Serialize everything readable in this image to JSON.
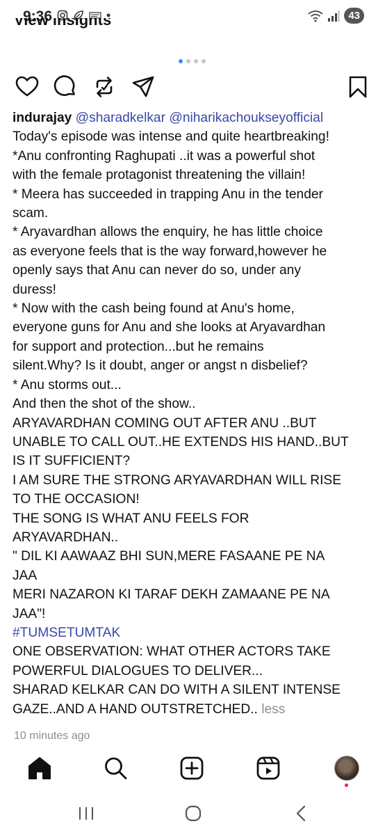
{
  "status_bar": {
    "time": "9:36",
    "battery": "43"
  },
  "header": {
    "view_insights": "View insights"
  },
  "carousel": {
    "dots": 4,
    "active_index": 0
  },
  "post": {
    "username": "indurajay",
    "mentions": [
      "@sharadkelkar",
      "@niharikachoukseyofficial"
    ],
    "caption_lines": [
      "Today's episode was intense and quite heartbreaking!",
      "*Anu confronting Raghupati ..it was a powerful shot",
      "with the female protagonist threatening the villain!",
      "* Meera has succeeded in trapping Anu in the tender",
      "scam.",
      "* Aryavardhan allows the enquiry, he has little choice",
      "as everyone feels that is the way forward,however he",
      "openly says that Anu can never do so, under any",
      "duress!",
      "* Now with the cash being found at Anu's home,",
      "everyone guns for Anu and she looks at Aryavardhan",
      "for support and protection...but he remains",
      "silent.Why? Is it doubt, anger or angst n disbelief?",
      "* Anu storms out...",
      "And then the shot of the show..",
      "ARYAVARDHAN COMING OUT AFTER ANU ..BUT",
      "UNABLE TO CALL OUT..HE EXTENDS HIS HAND..BUT",
      "IS IT SUFFICIENT?",
      "I AM SURE THE STRONG ARYAVARDHAN WILL RISE",
      "TO THE OCCASION!",
      "THE SONG IS WHAT ANU FEELS FOR",
      "ARYAVARDHAN..",
      "\" DIL KI AAWAAZ BHI SUN,MERE FASAANE PE NA",
      "JAA",
      "MERI NAZARON KI TARAF DEKH ZAMAANE PE NA",
      "JAA\"!"
    ],
    "hashtag": "#TUMSETUMTAK",
    "caption_tail_lines": [
      "ONE OBSERVATION: WHAT OTHER ACTORS TAKE",
      "POWERFUL DIALOGUES TO DELIVER...",
      "SHARAD KELKAR CAN DO WITH A SILENT INTENSE"
    ],
    "last_line": "GAZE..AND A HAND OUTSTRETCHED..",
    "less_label": "less",
    "timestamp": "10 minutes ago"
  },
  "icons": {
    "like": "heart-icon",
    "comment": "comment-icon",
    "repost": "repost-icon",
    "share": "share-icon",
    "save": "bookmark-icon"
  },
  "colors": {
    "link": "#3a48a8",
    "muted": "#8e8e8e",
    "active_dot": "#3b8bf5",
    "notification": "#e0245e"
  }
}
